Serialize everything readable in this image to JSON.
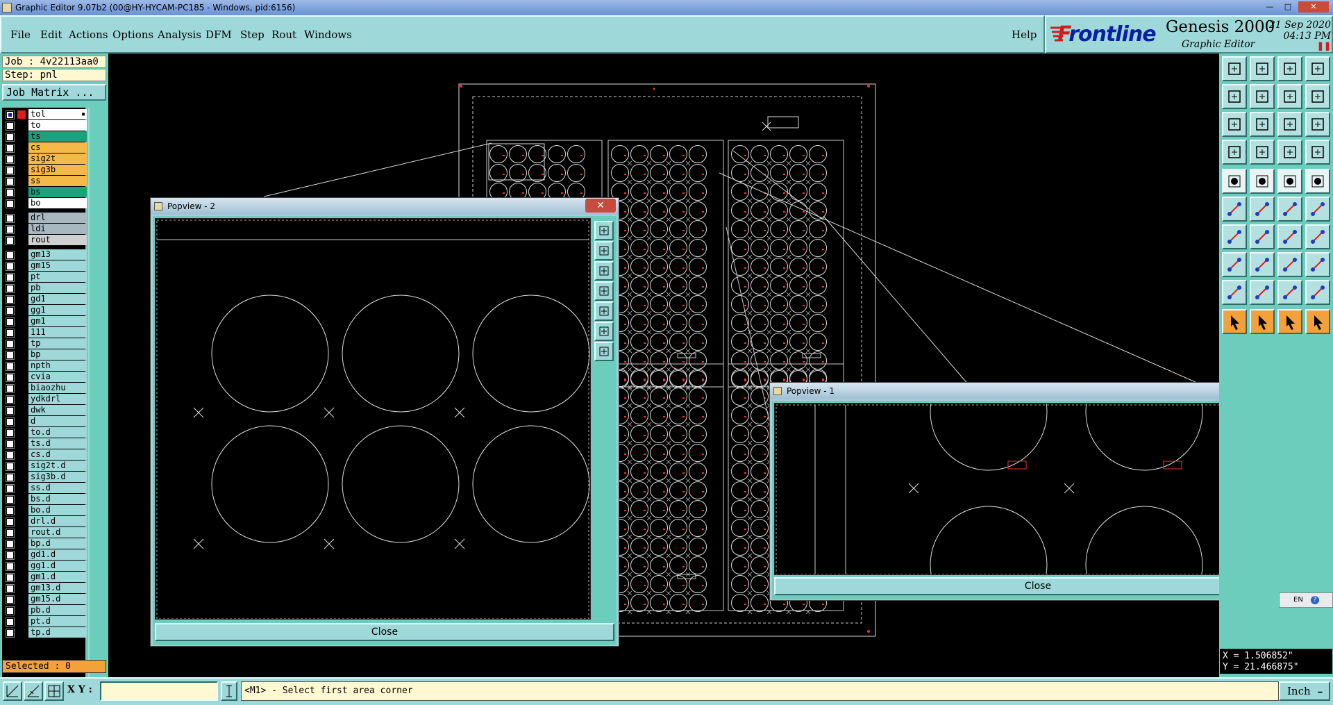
{
  "window": {
    "title": "Graphic Editor 9.07b2 (00@HY-HYCAM-PC185 - Windows, pid:6156)"
  },
  "menubar": {
    "items": [
      "File",
      "Edit",
      "Actions",
      "Options",
      "Analysis",
      "DFM",
      "Step",
      "Rout",
      "Windows"
    ],
    "help": "Help"
  },
  "brand": {
    "logo_prefix": "F",
    "logo_rest": "rontline",
    "product": "Genesis 2000",
    "subtitle": "Graphic Editor",
    "date": "21 Sep 2020",
    "time": "04:13 PM"
  },
  "left_panel": {
    "job": "Job : 4v22113aa0",
    "step": "Step: pnl",
    "job_matrix": "Job Matrix ...",
    "selected": "Selected : 0"
  },
  "layers": [
    {
      "name": "tol",
      "color": "#ffffff",
      "checked": true
    },
    {
      "name": "to",
      "color": "#ffffff",
      "checked": false
    },
    {
      "name": "ts",
      "color": "#1aa37a",
      "checked": false
    },
    {
      "name": "cs",
      "color": "#f5b94a",
      "checked": false
    },
    {
      "name": "sig2t",
      "color": "#f5b94a",
      "checked": false
    },
    {
      "name": "sig3b",
      "color": "#f5b94a",
      "checked": false
    },
    {
      "name": "ss",
      "color": "#f5b94a",
      "checked": false
    },
    {
      "name": "bs",
      "color": "#1aa37a",
      "checked": false
    },
    {
      "name": "bo",
      "color": "#ffffff",
      "checked": false
    },
    {
      "name": "drl",
      "color": "#a8b8c0",
      "checked": false,
      "gap": true
    },
    {
      "name": "ldi",
      "color": "#a8b8c0",
      "checked": false
    },
    {
      "name": "rout",
      "color": "#d0d0d0",
      "checked": false
    },
    {
      "name": "gm13",
      "color": "#9ed8d8",
      "checked": false,
      "gap": true
    },
    {
      "name": "gm15",
      "color": "#9ed8d8",
      "checked": false
    },
    {
      "name": "pt",
      "color": "#9ed8d8",
      "checked": false
    },
    {
      "name": "pb",
      "color": "#9ed8d8",
      "checked": false
    },
    {
      "name": "gd1",
      "color": "#9ed8d8",
      "checked": false
    },
    {
      "name": "gg1",
      "color": "#9ed8d8",
      "checked": false
    },
    {
      "name": "gm1",
      "color": "#9ed8d8",
      "checked": false
    },
    {
      "name": "111",
      "color": "#9ed8d8",
      "checked": false
    },
    {
      "name": "tp",
      "color": "#9ed8d8",
      "checked": false
    },
    {
      "name": "bp",
      "color": "#9ed8d8",
      "checked": false
    },
    {
      "name": "npth",
      "color": "#9ed8d8",
      "checked": false
    },
    {
      "name": "cvia",
      "color": "#9ed8d8",
      "checked": false
    },
    {
      "name": "biaozhu",
      "color": "#9ed8d8",
      "checked": false
    },
    {
      "name": "ydkdrl",
      "color": "#9ed8d8",
      "checked": false
    },
    {
      "name": "dwk",
      "color": "#9ed8d8",
      "checked": false
    },
    {
      "name": "d",
      "color": "#9ed8d8",
      "checked": false
    },
    {
      "name": "to.d",
      "color": "#9ed8d8",
      "checked": false
    },
    {
      "name": "ts.d",
      "color": "#9ed8d8",
      "checked": false
    },
    {
      "name": "cs.d",
      "color": "#9ed8d8",
      "checked": false
    },
    {
      "name": "sig2t.d",
      "color": "#9ed8d8",
      "checked": false
    },
    {
      "name": "sig3b.d",
      "color": "#9ed8d8",
      "checked": false
    },
    {
      "name": "ss.d",
      "color": "#9ed8d8",
      "checked": false
    },
    {
      "name": "bs.d",
      "color": "#9ed8d8",
      "checked": false
    },
    {
      "name": "bo.d",
      "color": "#9ed8d8",
      "checked": false
    },
    {
      "name": "drl.d",
      "color": "#9ed8d8",
      "checked": false
    },
    {
      "name": "rout.d",
      "color": "#9ed8d8",
      "checked": false
    },
    {
      "name": "bp.d",
      "color": "#9ed8d8",
      "checked": false
    },
    {
      "name": "gd1.d",
      "color": "#9ed8d8",
      "checked": false
    },
    {
      "name": "gg1.d",
      "color": "#9ed8d8",
      "checked": false
    },
    {
      "name": "gm1.d",
      "color": "#9ed8d8",
      "checked": false
    },
    {
      "name": "gm13.d",
      "color": "#9ed8d8",
      "checked": false
    },
    {
      "name": "gm15.d",
      "color": "#9ed8d8",
      "checked": false
    },
    {
      "name": "pb.d",
      "color": "#9ed8d8",
      "checked": false
    },
    {
      "name": "pt.d",
      "color": "#9ed8d8",
      "checked": false
    },
    {
      "name": "tp.d",
      "color": "#9ed8d8",
      "checked": false
    }
  ],
  "popview2": {
    "title": "Popview - 2",
    "close_label": "Close"
  },
  "popview1": {
    "title": "Popview - 1",
    "close_label": "Close"
  },
  "coords": {
    "x": "X = 1.506852\"",
    "y": "Y = 21.466875\""
  },
  "statusbar": {
    "xy_label": "X Y :",
    "xy_value": "",
    "prompt": "<M1> - Select first area corner",
    "units": "Inch"
  },
  "lang_indicator": "EN",
  "colors": {
    "panel": "#6dcdbd",
    "button": "#9ed8d8",
    "highlight": "#f5a13a",
    "canvas": "#000000"
  }
}
